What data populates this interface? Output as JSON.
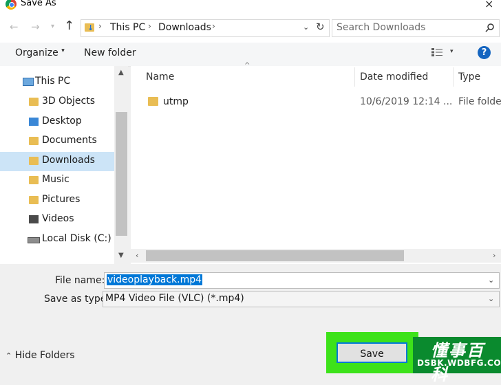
{
  "window": {
    "title": "Save As",
    "close_glyph": "×"
  },
  "address": {
    "path": [
      "This PC",
      "Downloads"
    ],
    "sep": "›",
    "search_placeholder": "Search Downloads"
  },
  "toolbar": {
    "organize": "Organize",
    "new_folder": "New folder",
    "help": "?"
  },
  "nav": {
    "items": [
      {
        "label": "This PC",
        "icon": "pc-icon",
        "selected": false
      },
      {
        "label": "3D Objects",
        "icon": "folder-3d-icon",
        "selected": false
      },
      {
        "label": "Desktop",
        "icon": "desktop-folder-icon",
        "selected": false
      },
      {
        "label": "Documents",
        "icon": "documents-folder-icon",
        "selected": false
      },
      {
        "label": "Downloads",
        "icon": "downloads-folder-icon",
        "selected": true
      },
      {
        "label": "Music",
        "icon": "music-folder-icon",
        "selected": false
      },
      {
        "label": "Pictures",
        "icon": "pictures-folder-icon",
        "selected": false
      },
      {
        "label": "Videos",
        "icon": "videos-folder-icon",
        "selected": false
      },
      {
        "label": "Local Disk (C:)",
        "icon": "drive-icon",
        "selected": false
      }
    ]
  },
  "files": {
    "columns": [
      "Name",
      "Date modified",
      "Type"
    ],
    "rows": [
      {
        "name": "utmp",
        "date": "10/6/2019 12:14 ...",
        "type": "File folder"
      }
    ]
  },
  "form": {
    "file_name_label": "File name:",
    "file_name_value": "videoplayback.mp4",
    "type_label": "Save as type:",
    "type_value": "MP4 Video File (VLC) (*.mp4)",
    "hide_folders": "Hide Folders",
    "save": "Save"
  },
  "watermark": {
    "cn": "懂事百科",
    "url": "DSBK.WDBFG.COM"
  }
}
